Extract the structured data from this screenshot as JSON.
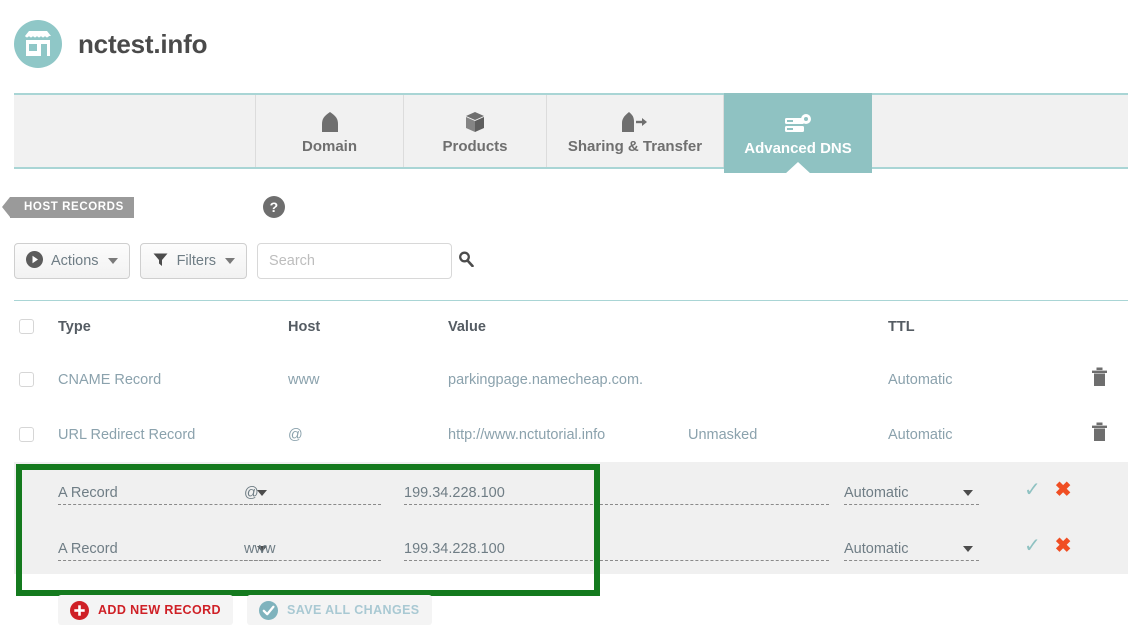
{
  "header": {
    "site_name": "nctest.info",
    "avatar_icon": "storefront-icon"
  },
  "tabs": [
    {
      "label": "Domain",
      "icon": "house-icon",
      "active": false
    },
    {
      "label": "Products",
      "icon": "box-icon",
      "active": false
    },
    {
      "label": "Sharing & Transfer",
      "icon": "house-arrow-icon",
      "active": false
    },
    {
      "label": "Advanced DNS",
      "icon": "server-gear-icon",
      "active": true
    }
  ],
  "section": {
    "banner_label": "HOST RECORDS",
    "help_icon": "question-mark-icon"
  },
  "toolbar": {
    "actions_label": "Actions",
    "actions_icon": "play-circle-icon",
    "filters_label": "Filters",
    "filters_icon": "funnel-icon",
    "search_placeholder": "Search",
    "search_value": "",
    "search_icon": "magnifier-icon"
  },
  "table": {
    "columns": {
      "type": "Type",
      "host": "Host",
      "value": "Value",
      "ttl": "TTL"
    },
    "rows": [
      {
        "type": "CNAME Record",
        "host": "www",
        "value": "parkingpage.namecheap.com.",
        "extra": "",
        "ttl": "Automatic",
        "delete_icon": "trash-icon",
        "editing": false
      },
      {
        "type": "URL Redirect Record",
        "host": "@",
        "value": "http://www.nctutorial.info",
        "extra": "Unmasked",
        "ttl": "Automatic",
        "delete_icon": "trash-icon",
        "editing": false
      },
      {
        "type": "A Record",
        "host": "@",
        "value": "199.34.228.100",
        "extra": "",
        "ttl": "Automatic",
        "confirm_icon": "check-icon",
        "cancel_icon": "x-icon",
        "editing": true
      },
      {
        "type": "A Record",
        "host": "www",
        "value": "199.34.228.100",
        "extra": "",
        "ttl": "Automatic",
        "confirm_icon": "check-icon",
        "cancel_icon": "x-icon",
        "editing": true
      }
    ]
  },
  "footer": {
    "add_label": "ADD NEW RECORD",
    "add_icon": "plus-circle-icon",
    "save_label": "SAVE ALL CHANGES",
    "save_icon": "check-circle-icon"
  },
  "annotation": {
    "color": "#147a1e",
    "shape": "rectangle-highlight"
  },
  "colors": {
    "teal": "#8fc2c2",
    "teal_light": "#a9d5d5",
    "red": "#cf2026",
    "orange": "#f04e23",
    "green_highlight": "#147a1e",
    "text_gray": "#6f7d85"
  }
}
